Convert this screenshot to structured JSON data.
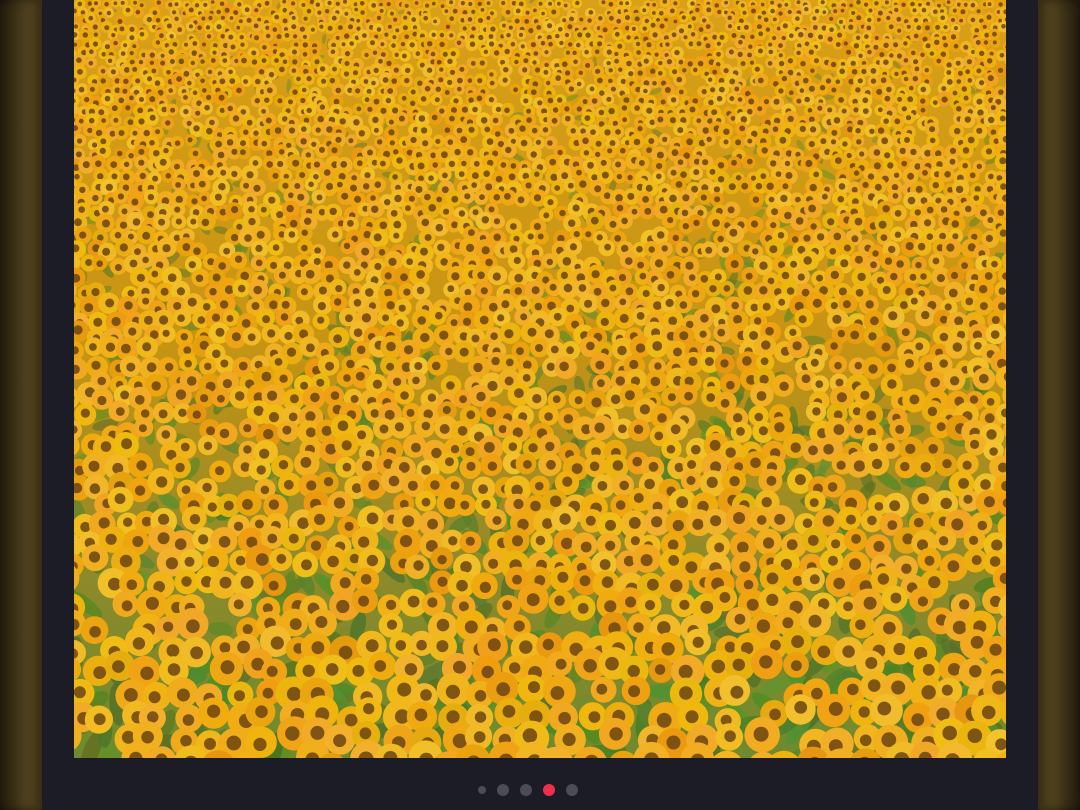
{
  "photo": {
    "alt": "",
    "subject": "sunflower-field"
  },
  "pager": {
    "count": 5,
    "active_index": 3,
    "colors": {
      "active": "#f0304a",
      "inactive": "#4b4c56"
    }
  },
  "theme": {
    "card_background": "#1b1c25",
    "petal": "#f2b51d",
    "disk": "#6b4410",
    "leaf": "#5f8a2c"
  }
}
